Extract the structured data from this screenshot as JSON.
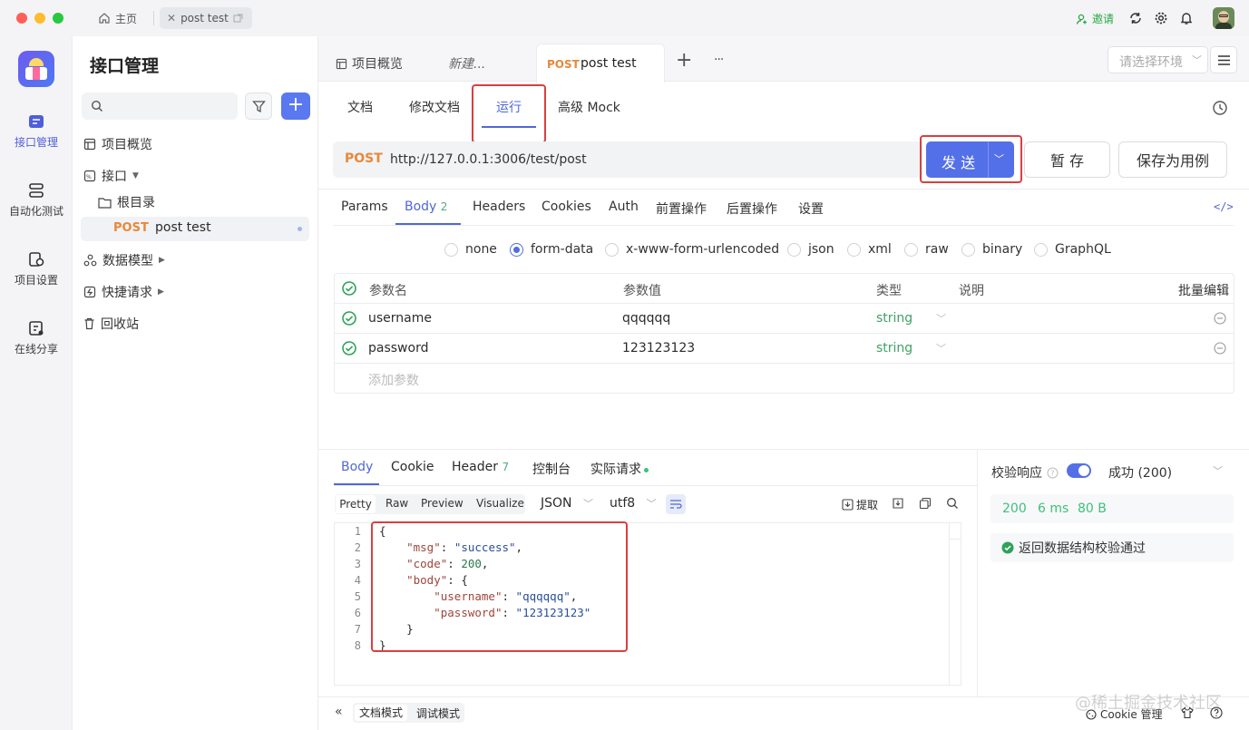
{
  "titlebar": {
    "home_tab": "主页",
    "active_tab": "post test",
    "invite": "邀请"
  },
  "rail": {
    "items": [
      {
        "label": "接口管理",
        "icon": "api-management-icon"
      },
      {
        "label": "自动化测试",
        "icon": "automation-test-icon"
      },
      {
        "label": "项目设置",
        "icon": "project-settings-icon"
      },
      {
        "label": "在线分享",
        "icon": "online-share-icon"
      }
    ]
  },
  "sidebar": {
    "title": "接口管理",
    "tree": {
      "overview": "项目概览",
      "apis": "接口",
      "root": "根目录",
      "api_method": "POST",
      "api_name": "post test",
      "models": "数据模型",
      "quick": "快捷请求",
      "trash": "回收站"
    }
  },
  "tabs": {
    "overview": "项目概览",
    "new": "新建...",
    "active_method": "POST",
    "active_name": "post test",
    "add": "+",
    "more": "···",
    "env_placeholder": "请选择环境"
  },
  "subtabs": [
    "文档",
    "修改文档",
    "运行",
    "高级 Mock"
  ],
  "request": {
    "method": "POST",
    "url": "http://127.0.0.1:3006/test/post",
    "send": "发 送",
    "save": "暂 存",
    "save_case": "保存为用例"
  },
  "param_tabs": {
    "params": "Params",
    "body": "Body",
    "body_count": "2",
    "headers": "Headers",
    "cookies": "Cookies",
    "auth": "Auth",
    "pre": "前置操作",
    "post": "后置操作",
    "settings": "设置"
  },
  "body_types": [
    "none",
    "form-data",
    "x-www-form-urlencoded",
    "json",
    "xml",
    "raw",
    "binary",
    "GraphQL"
  ],
  "params_table": {
    "headers": {
      "name": "参数名",
      "value": "参数值",
      "type": "类型",
      "desc": "说明",
      "bulk": "批量编辑"
    },
    "rows": [
      {
        "name": "username",
        "value": "qqqqqq",
        "type": "string"
      },
      {
        "name": "password",
        "value": "123123123",
        "type": "string"
      }
    ],
    "add_placeholder": "添加参数"
  },
  "response": {
    "tabs": {
      "body": "Body",
      "cookie": "Cookie",
      "header": "Header",
      "header_count": "7",
      "console": "控制台",
      "actual": "实际请求"
    },
    "view_modes": [
      "Pretty",
      "Raw",
      "Preview",
      "Visualize"
    ],
    "format": "JSON",
    "encoding": "utf8",
    "extract": "提取",
    "line_numbers": [
      "1",
      "2",
      "3",
      "4",
      "5",
      "6",
      "7",
      "8"
    ],
    "json": {
      "k_msg": "\"msg\"",
      "v_msg": "\"success\"",
      "k_code": "\"code\"",
      "v_code": "200",
      "k_body": "\"body\"",
      "k_user": "\"username\"",
      "v_user": "\"qqqqqq\"",
      "k_pass": "\"password\"",
      "v_pass": "\"123123123\""
    }
  },
  "validation": {
    "label": "校验响应",
    "status": "成功 (200)",
    "code": "200",
    "time": "6 ms",
    "size": "80 B",
    "message": "返回数据结构校验通过"
  },
  "footer": {
    "doc_mode": "文档模式",
    "debug_mode": "调试模式",
    "cookie": "Cookie 管理",
    "watermark": "@稀土掘金技术社区"
  }
}
